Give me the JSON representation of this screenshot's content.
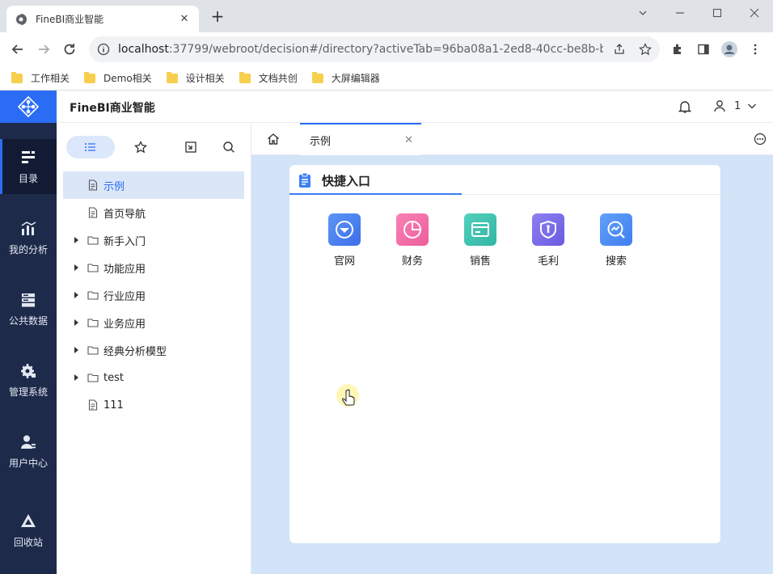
{
  "browser": {
    "tab_title": "FineBI商业智能",
    "url_host": "localhost",
    "url_rest": ":37799/webroot/decision#/directory?activeTab=96ba08a1-2ed8-40cc-be8b-b3...",
    "bookmarks": [
      "工作相关",
      "Demo相关",
      "设计相关",
      "文档共创",
      "大屏编辑器"
    ]
  },
  "app": {
    "brand": "FineBI商业智能",
    "user_label": "1",
    "accent": "#2a6df4"
  },
  "leftnav": [
    {
      "label": "目录",
      "icon": "directory-icon",
      "active": true
    },
    {
      "label": "我的分析",
      "icon": "analysis-icon"
    },
    {
      "label": "公共数据",
      "icon": "database-icon"
    },
    {
      "label": "管理系统",
      "icon": "gear-icon"
    },
    {
      "label": "用户中心",
      "icon": "user-icon"
    },
    {
      "label": "回收站",
      "icon": "recycle-icon"
    }
  ],
  "tree": [
    {
      "label": "示例",
      "type": "file",
      "selected": true
    },
    {
      "label": "首页导航",
      "type": "file"
    },
    {
      "label": "新手入门",
      "type": "folder"
    },
    {
      "label": "功能应用",
      "type": "folder"
    },
    {
      "label": "行业应用",
      "type": "folder"
    },
    {
      "label": "业务应用",
      "type": "folder"
    },
    {
      "label": "经典分析模型",
      "type": "folder"
    },
    {
      "label": "test",
      "type": "folder"
    },
    {
      "label": "111",
      "type": "file"
    }
  ],
  "content": {
    "tab_label": "示例",
    "card_title": "快捷入口",
    "shortcuts": [
      {
        "label": "官网",
        "color": "#4e82f0"
      },
      {
        "label": "财务",
        "color": "#f26aa6"
      },
      {
        "label": "销售",
        "color": "#3ec3b0"
      },
      {
        "label": "毛利",
        "color": "#7b6ee8"
      },
      {
        "label": "搜索",
        "color": "#4b8ef5"
      }
    ]
  }
}
